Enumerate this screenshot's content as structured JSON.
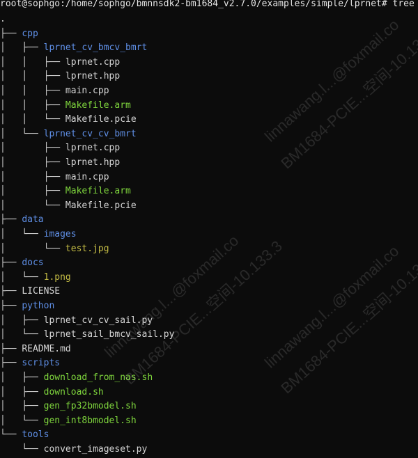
{
  "terminal": {
    "prompt": "root@sophgo:/home/sophgo/bmnnsdk2-bm1684_v2.7.0/examples/simple/lprnet# tree",
    "lines": [
      {
        "prefix": ".",
        "name": "",
        "kind": "plain"
      },
      {
        "prefix": "├── ",
        "name": "cpp",
        "kind": "dir"
      },
      {
        "prefix": "│   ├── ",
        "name": "lprnet_cv_bmcv_bmrt",
        "kind": "dir"
      },
      {
        "prefix": "│   │   ├── ",
        "name": "lprnet.cpp",
        "kind": "plain"
      },
      {
        "prefix": "│   │   ├── ",
        "name": "lprnet.hpp",
        "kind": "plain"
      },
      {
        "prefix": "│   │   ├── ",
        "name": "main.cpp",
        "kind": "plain"
      },
      {
        "prefix": "│   │   ├── ",
        "name": "Makefile.arm",
        "kind": "exec"
      },
      {
        "prefix": "│   │   └── ",
        "name": "Makefile.pcie",
        "kind": "plain"
      },
      {
        "prefix": "│   └── ",
        "name": "lprnet_cv_cv_bmrt",
        "kind": "dir"
      },
      {
        "prefix": "│       ├── ",
        "name": "lprnet.cpp",
        "kind": "plain"
      },
      {
        "prefix": "│       ├── ",
        "name": "lprnet.hpp",
        "kind": "plain"
      },
      {
        "prefix": "│       ├── ",
        "name": "main.cpp",
        "kind": "plain"
      },
      {
        "prefix": "│       ├── ",
        "name": "Makefile.arm",
        "kind": "exec"
      },
      {
        "prefix": "│       └── ",
        "name": "Makefile.pcie",
        "kind": "plain"
      },
      {
        "prefix": "├── ",
        "name": "data",
        "kind": "dir"
      },
      {
        "prefix": "│   └── ",
        "name": "images",
        "kind": "dir"
      },
      {
        "prefix": "│       └── ",
        "name": "test.jpg",
        "kind": "img"
      },
      {
        "prefix": "├── ",
        "name": "docs",
        "kind": "dir"
      },
      {
        "prefix": "│   └── ",
        "name": "1.png",
        "kind": "img"
      },
      {
        "prefix": "├── ",
        "name": "LICENSE",
        "kind": "plain"
      },
      {
        "prefix": "├── ",
        "name": "python",
        "kind": "dir"
      },
      {
        "prefix": "│   ├── ",
        "name": "lprnet_cv_cv_sail.py",
        "kind": "plain"
      },
      {
        "prefix": "│   └── ",
        "name": "lprnet_sail_bmcv_sail.py",
        "kind": "plain"
      },
      {
        "prefix": "├── ",
        "name": "README.md",
        "kind": "plain"
      },
      {
        "prefix": "├── ",
        "name": "scripts",
        "kind": "dir"
      },
      {
        "prefix": "│   ├── ",
        "name": "download_from_nas.sh",
        "kind": "exec"
      },
      {
        "prefix": "│   ├── ",
        "name": "download.sh",
        "kind": "exec"
      },
      {
        "prefix": "│   ├── ",
        "name": "gen_fp32bmodel.sh",
        "kind": "exec"
      },
      {
        "prefix": "│   └── ",
        "name": "gen_int8bmodel.sh",
        "kind": "exec"
      },
      {
        "prefix": "└── ",
        "name": "tools",
        "kind": "dir"
      },
      {
        "prefix": "    └── ",
        "name": "convert_imageset.py",
        "kind": "plain"
      }
    ]
  },
  "watermarks": [
    "linnawang.l...@foxmail.co",
    "BM1684-PCIE...空间-10.133.3",
    "linnawang.l...@foxmail.co",
    "BM1684-PCIE...空间-10.133.3",
    "linnawang.l...@foxmail.co",
    "BM1684-PCIE...空间-10.133.3"
  ],
  "colors": {
    "background": "#0c0c0c",
    "directory": "#5f8fe6",
    "executable": "#7fd63d",
    "image": "#c5bd45",
    "text": "#d6d6d6"
  }
}
